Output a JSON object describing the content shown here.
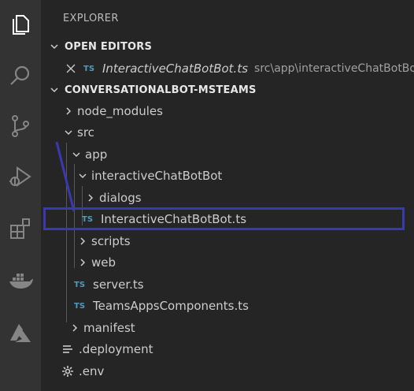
{
  "explorer": {
    "title": "EXPLORER"
  },
  "open_editors": {
    "header": "OPEN EDITORS",
    "items": [
      {
        "badge": "TS",
        "name": "InteractiveChatBotBot.ts",
        "path": "src\\app\\interactiveChatBotBot"
      }
    ]
  },
  "workspace": {
    "header": "CONVERSATIONALBOT-MSTEAMS",
    "tree": [
      {
        "label": "node_modules"
      },
      {
        "label": "src"
      },
      {
        "label": "app"
      },
      {
        "label": "interactiveChatBotBot"
      },
      {
        "label": "dialogs"
      },
      {
        "label": "InteractiveChatBotBot.ts",
        "badge": "TS"
      },
      {
        "label": "scripts"
      },
      {
        "label": "web"
      },
      {
        "label": "server.ts",
        "badge": "TS"
      },
      {
        "label": "TeamsAppsComponents.ts",
        "badge": "TS"
      },
      {
        "label": "manifest"
      },
      {
        "label": ".deployment"
      },
      {
        "label": ".env"
      }
    ]
  },
  "activity_bar": {
    "icons": [
      "explorer-icon",
      "search-icon",
      "source-control-icon",
      "run-debug-icon",
      "extensions-icon",
      "docker-icon",
      "azure-icon"
    ]
  },
  "colors": {
    "ts": "#519aba",
    "highlight": "#3b39b2",
    "annotation": "#3b39b2"
  }
}
